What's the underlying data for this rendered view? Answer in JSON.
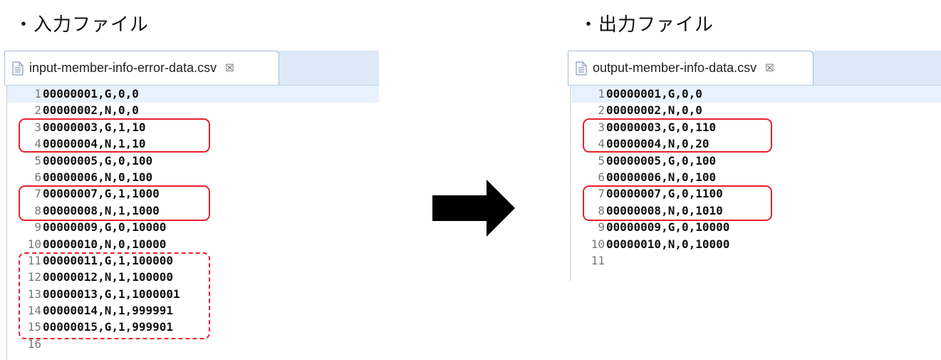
{
  "input": {
    "heading": "・入力ファイル",
    "tab_title": "input-member-info-error-data.csv",
    "close_glyph": "☒",
    "lines": [
      {
        "no": "1",
        "text": "00000001,G,0,0"
      },
      {
        "no": "2",
        "text": "00000002,N,0,0"
      },
      {
        "no": "3",
        "text": "00000003,G,1,10"
      },
      {
        "no": "4",
        "text": "00000004,N,1,10"
      },
      {
        "no": "5",
        "text": "00000005,G,0,100"
      },
      {
        "no": "6",
        "text": "00000006,N,0,100"
      },
      {
        "no": "7",
        "text": "00000007,G,1,1000"
      },
      {
        "no": "8",
        "text": "00000008,N,1,1000"
      },
      {
        "no": "9",
        "text": "00000009,G,0,10000"
      },
      {
        "no": "10",
        "text": "00000010,N,0,10000"
      },
      {
        "no": "11",
        "text": "00000011,G,1,100000"
      },
      {
        "no": "12",
        "text": "00000012,N,1,100000"
      },
      {
        "no": "13",
        "text": "00000013,G,1,1000001"
      },
      {
        "no": "14",
        "text": "00000014,N,1,999991"
      },
      {
        "no": "15",
        "text": "00000015,G,1,999901"
      },
      {
        "no": "16",
        "text": ""
      }
    ]
  },
  "output": {
    "heading": "・出力ファイル",
    "tab_title": "output-member-info-data.csv",
    "close_glyph": "☒",
    "lines": [
      {
        "no": "1",
        "text": "00000001,G,0,0"
      },
      {
        "no": "2",
        "text": "00000002,N,0,0"
      },
      {
        "no": "3",
        "text": "00000003,G,0,110"
      },
      {
        "no": "4",
        "text": "00000004,N,0,20"
      },
      {
        "no": "5",
        "text": "00000005,G,0,100"
      },
      {
        "no": "6",
        "text": "00000006,N,0,100"
      },
      {
        "no": "7",
        "text": "00000007,G,0,1100"
      },
      {
        "no": "8",
        "text": "00000008,N,0,1010"
      },
      {
        "no": "9",
        "text": "00000009,G,0,10000"
      },
      {
        "no": "10",
        "text": "00000010,N,0,10000"
      },
      {
        "no": "11",
        "text": ""
      }
    ]
  },
  "colors": {
    "highlight_box": "#e8212e",
    "tab_bar": "#dde9f6",
    "current_line": "#e8f2fe"
  },
  "icons": {
    "file": "file-text-icon",
    "close": "close-icon",
    "arrow": "arrow-right-icon"
  }
}
